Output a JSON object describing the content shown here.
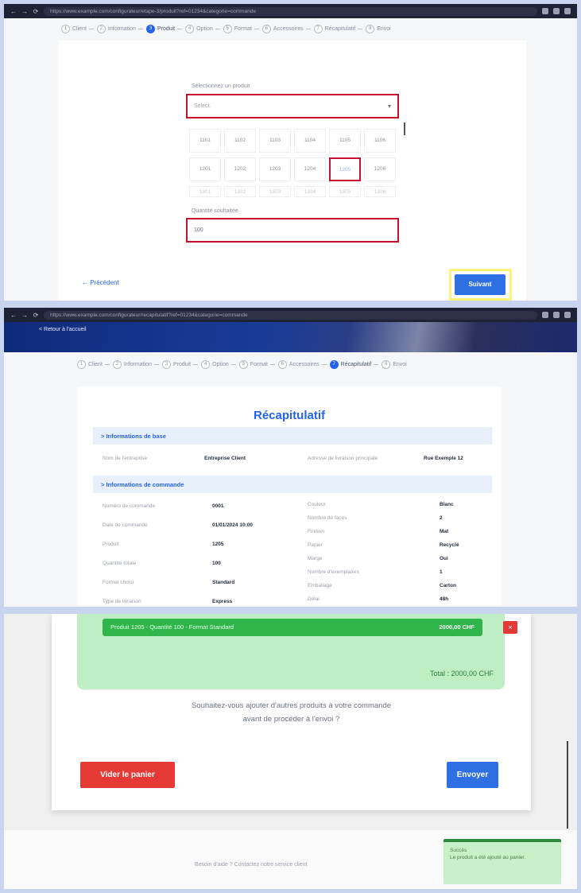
{
  "browser": {
    "url_1": "https://www.example.com/configurateur/etape-3/produit?ref=01234&categorie=commande",
    "url_2": "https://www.example.com/configurateur/recapitulatif?ref=01234&categorie=commande",
    "back": "←",
    "forward": "→",
    "reload": "⟳"
  },
  "stepper_1": [
    {
      "num": "1",
      "label": "Client",
      "active": false
    },
    {
      "num": "2",
      "label": "Information",
      "active": false
    },
    {
      "num": "3",
      "label": "Produit",
      "active": true
    },
    {
      "num": "4",
      "label": "Option",
      "active": false
    },
    {
      "num": "5",
      "label": "Format",
      "active": false
    },
    {
      "num": "6",
      "label": "Accessoires",
      "active": false
    },
    {
      "num": "7",
      "label": "Récapitulatif",
      "active": false
    },
    {
      "num": "8",
      "label": "Envoi",
      "active": false
    }
  ],
  "stepper_2": [
    {
      "num": "1",
      "label": "Client",
      "active": false
    },
    {
      "num": "2",
      "label": "Information",
      "active": false
    },
    {
      "num": "3",
      "label": "Produit",
      "active": false
    },
    {
      "num": "4",
      "label": "Option",
      "active": false
    },
    {
      "num": "5",
      "label": "Format",
      "active": false
    },
    {
      "num": "6",
      "label": "Accessoires",
      "active": false
    },
    {
      "num": "7",
      "label": "Récapitulatif",
      "active": true
    },
    {
      "num": "8",
      "label": "Envoi",
      "active": false
    }
  ],
  "panel1": {
    "select_label": "Sélectionnez un produit",
    "select_value": "Sélect.",
    "grid": [
      [
        "1101",
        "1102",
        "1103",
        "1104",
        "1105",
        "1106"
      ],
      [
        "1201",
        "1202",
        "1203",
        "1204",
        "1205",
        "1206"
      ],
      [
        "1301",
        "1302",
        "1303",
        "1304",
        "1305",
        "1306"
      ]
    ],
    "selected_cell": "1205",
    "quantity_label": "Quantité souhaitée",
    "quantity_value": "100",
    "previous_label": "← Précédent",
    "next_label": "Suivant"
  },
  "panel2": {
    "banner_text": "< Retour à l'accueil",
    "title": "Récapitulatif",
    "section1": "> Informations de base",
    "section1_rows": [
      {
        "k": "Nom de l'entreprise",
        "v": "Entreprise Client",
        "k2": "Adresse de livraison principale",
        "v2": "Rue Exemple 12"
      }
    ],
    "section2": "> Informations de commande",
    "section2_left": [
      {
        "k": "Numéro de commande",
        "v": "0001"
      },
      {
        "k": "Date de commande",
        "v": "01/01/2024 10:00"
      },
      {
        "k": "Produit",
        "v": "1205"
      },
      {
        "k": "Quantité totale",
        "v": "100"
      },
      {
        "k": "Format choisi",
        "v": "Standard"
      },
      {
        "k": "Type de livraison",
        "v": "Express"
      }
    ],
    "section2_right": [
      {
        "k": "Couleur",
        "v": "Blanc"
      },
      {
        "k": "Nombre de faces",
        "v": "2"
      },
      {
        "k": "Finition",
        "v": "Mat"
      },
      {
        "k": "Papier",
        "v": "Recyclé"
      },
      {
        "k": "Marge",
        "v": "Oui"
      },
      {
        "k": "Nombre d'exemplaires",
        "v": "1"
      },
      {
        "k": "Emballage",
        "v": "Carton"
      },
      {
        "k": "Délai",
        "v": "48h"
      }
    ]
  },
  "panel3": {
    "item_text": "Produit 1205 - Quantité 100 - Format Standard",
    "item_amount": "2000,00 CHF",
    "delete_icon": "×",
    "total": "Total : 2000,00 CHF",
    "question_line1": "Souhaitez-vous ajouter d'autres produits à votre commande",
    "question_line2": "avant de procéder à l'envoi ?",
    "clear_label": "Vider le panier",
    "send_label": "Envoyer",
    "footer_text": "Besoin d'aide ? Contactez notre service client",
    "toast_title": "Succès",
    "toast_body": "Le produit a été ajouté au panier."
  },
  "colors": {
    "primary": "#2f6fe4",
    "danger": "#e53935",
    "success": "#2fb54a",
    "highlight": "#fff275",
    "annotation": "#c8102e"
  }
}
